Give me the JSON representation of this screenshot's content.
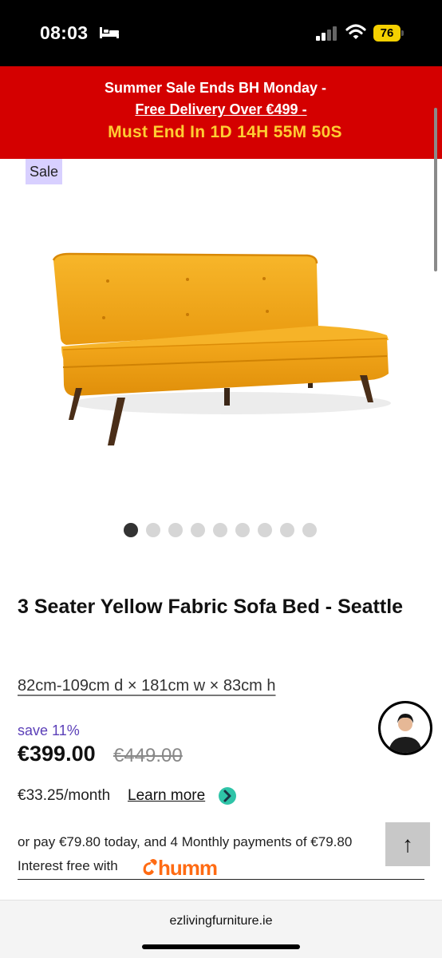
{
  "status_bar": {
    "time": "08:03",
    "battery": "76",
    "icons": [
      "bed-icon",
      "signal-icon",
      "wifi-icon",
      "battery-icon"
    ]
  },
  "promo": {
    "line1": "Summer Sale Ends BH Monday -",
    "line2": "Free Delivery Over €499 -",
    "line3": "Must End In 1D 14H 55M 50S",
    "colors": {
      "background": "#d40000",
      "countdown": "#ffcc33"
    }
  },
  "product": {
    "badge": "Sale",
    "image_icon": "yellow-sofa-bed-image",
    "gallery": {
      "count": 9,
      "active_index": 0
    },
    "title": "3 Seater Yellow Fabric Sofa Bed - Seattle",
    "dimensions": "82cm-109cm d × 181cm w × 83cm h",
    "save": "save 11%",
    "price": "€399.00",
    "old_price": "€449.00",
    "monthly": "€33.25/month",
    "learn_more": "Learn more",
    "pay_line": "or pay €79.80 today, and 4 Monthly payments of €79.80",
    "interest": "Interest free with",
    "humm_logo_text": "humm",
    "colors": {
      "sale_badge": "#d8d0ff",
      "save_text": "#5b3fb8",
      "humm": "#ff6b13"
    }
  },
  "floating": {
    "chat_icon": "support-agent-avatar",
    "back_to_top": "↑"
  },
  "browser": {
    "url": "ezlivingfurniture.ie"
  }
}
